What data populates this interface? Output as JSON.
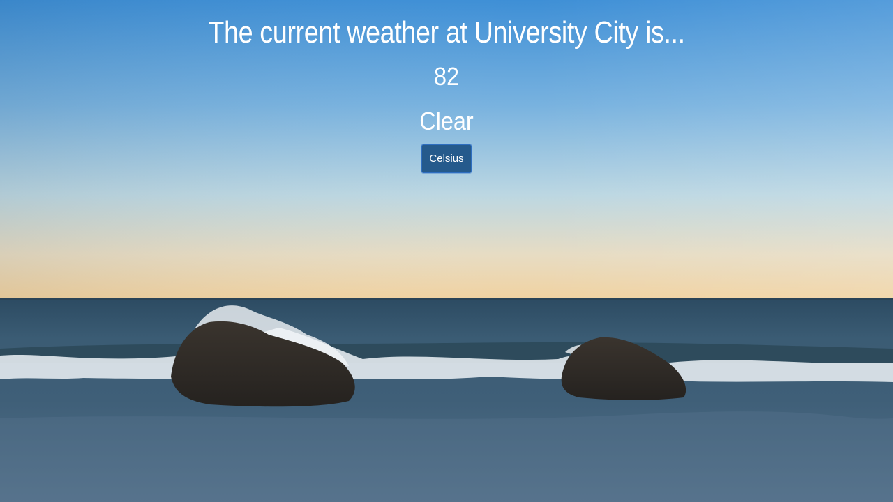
{
  "weather": {
    "headline": "The current weather at University City is...",
    "temperature": "82",
    "condition": "Clear",
    "unit_toggle_label": "Celsius"
  },
  "colors": {
    "sky_top": "#3f93d8",
    "sky_mid": "#b7d7e6",
    "horizon": "#f4d9a8",
    "sea": "#3b5a73",
    "button_bg": "#255a8c",
    "text": "#ffffff"
  }
}
